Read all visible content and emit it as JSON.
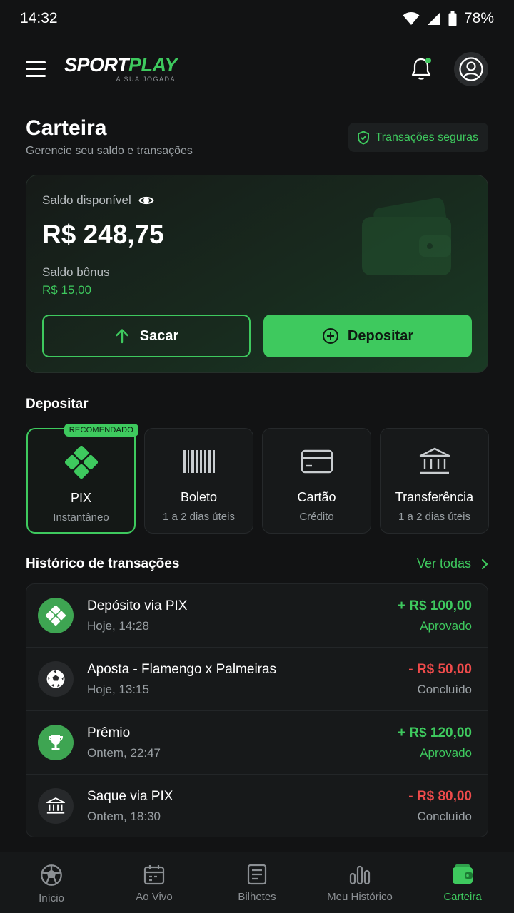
{
  "status_bar": {
    "time": "14:32",
    "battery": "78%"
  },
  "header": {
    "logo_sport": "SPORT",
    "logo_play": "PLAY",
    "logo_tagline": "A SUA JOGADA"
  },
  "page": {
    "title": "Carteira",
    "subtitle": "Gerencie seu saldo e transações",
    "secure_badge": "Transações seguras"
  },
  "wallet": {
    "balance_label": "Saldo disponível",
    "balance_value": "R$ 248,75",
    "bonus_label": "Saldo bônus",
    "bonus_value": "R$ 15,00",
    "withdraw_label": "Sacar",
    "deposit_label": "Depositar"
  },
  "deposit_section": {
    "title": "Depositar",
    "recommended_badge": "RECOMENDADO",
    "methods": [
      {
        "name": "PIX",
        "subtitle": "Instantâneo",
        "icon": "pix-icon",
        "selected": true
      },
      {
        "name": "Boleto",
        "subtitle": "1 a 2 dias úteis",
        "icon": "barcode-icon",
        "selected": false
      },
      {
        "name": "Cartão",
        "subtitle": "Crédito",
        "icon": "credit-card-icon",
        "selected": false
      },
      {
        "name": "Transferência",
        "subtitle": "1 a 2 dias úteis",
        "icon": "bank-icon",
        "selected": false
      }
    ]
  },
  "history": {
    "title": "Histórico de transações",
    "see_all": "Ver todas",
    "transactions": [
      {
        "title": "Depósito via PIX",
        "time": "Hoje, 14:28",
        "amount": "+ R$ 100,00",
        "status": "Aprovado",
        "icon": "pix-icon"
      },
      {
        "title": "Aposta - Flamengo x Palmeiras",
        "time": "Hoje, 13:15",
        "amount": "- R$ 50,00",
        "status": "Concluído",
        "icon": "soccer-ball-icon"
      },
      {
        "title": "Prêmio",
        "time": "Ontem, 22:47",
        "amount": "+ R$ 120,00",
        "status": "Aprovado",
        "icon": "trophy-icon"
      },
      {
        "title": "Saque via PIX",
        "time": "Ontem, 18:30",
        "amount": "- R$ 80,00",
        "status": "Concluído",
        "icon": "bank-icon"
      }
    ]
  },
  "bottom_nav": {
    "items": [
      {
        "label": "Início",
        "icon": "soccer-ball-icon"
      },
      {
        "label": "Ao Vivo",
        "icon": "calendar-icon"
      },
      {
        "label": "Bilhetes",
        "icon": "ticket-icon"
      },
      {
        "label": "Meu Histórico",
        "icon": "bar-chart-icon"
      },
      {
        "label": "Carteira",
        "icon": "wallet-icon",
        "active": true
      }
    ]
  },
  "colors": {
    "accent": "#3ec95e",
    "background": "#121314",
    "negative": "#ef4b4b"
  }
}
